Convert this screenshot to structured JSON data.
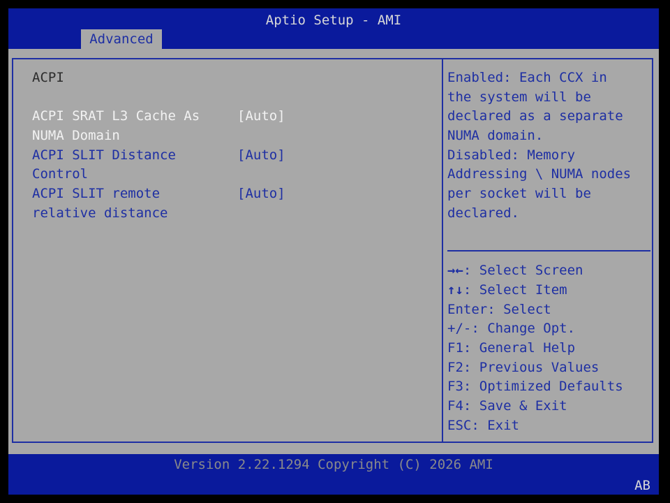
{
  "header": {
    "title": "Aptio Setup - AMI",
    "tabs": [
      {
        "label": "Advanced"
      }
    ]
  },
  "main": {
    "section_title": "ACPI",
    "settings": [
      {
        "label_lines": [
          "ACPI SRAT L3 Cache As",
          "NUMA Domain"
        ],
        "value": "[Auto]",
        "highlighted": true
      },
      {
        "label_lines": [
          "ACPI SLIT Distance",
          "Control"
        ],
        "value": "[Auto]",
        "highlighted": false
      },
      {
        "label_lines": [
          "ACPI SLIT remote",
          "relative distance"
        ],
        "value": "[Auto]",
        "highlighted": false
      }
    ]
  },
  "help": {
    "lines": [
      "Enabled: Each CCX in",
      "the system will be",
      "declared as a separate",
      "NUMA domain.",
      "Disabled: Memory",
      "Addressing \\ NUMA nodes",
      "per socket will be",
      "declared."
    ]
  },
  "keys": [
    {
      "key": "→←",
      "desc": ": Select Screen"
    },
    {
      "key": "↑↓",
      "desc": ": Select Item"
    },
    {
      "key": "",
      "desc": "Enter: Select"
    },
    {
      "key": "",
      "desc": "+/-: Change Opt."
    },
    {
      "key": "",
      "desc": "F1: General Help"
    },
    {
      "key": "",
      "desc": "F2: Previous Values"
    },
    {
      "key": "",
      "desc": "F3: Optimized Defaults"
    },
    {
      "key": "",
      "desc": "F4: Save & Exit"
    },
    {
      "key": "",
      "desc": "ESC: Exit"
    }
  ],
  "footer": {
    "version": "Version 2.22.1294 Copyright (C) 2026 AMI",
    "badge": "AB"
  },
  "colors": {
    "bar_blue": "#0a1a9c",
    "panel_gray": "#a8a8a8",
    "text_blue": "#1e2fa3",
    "highlight_white": "#f2f2f2"
  }
}
